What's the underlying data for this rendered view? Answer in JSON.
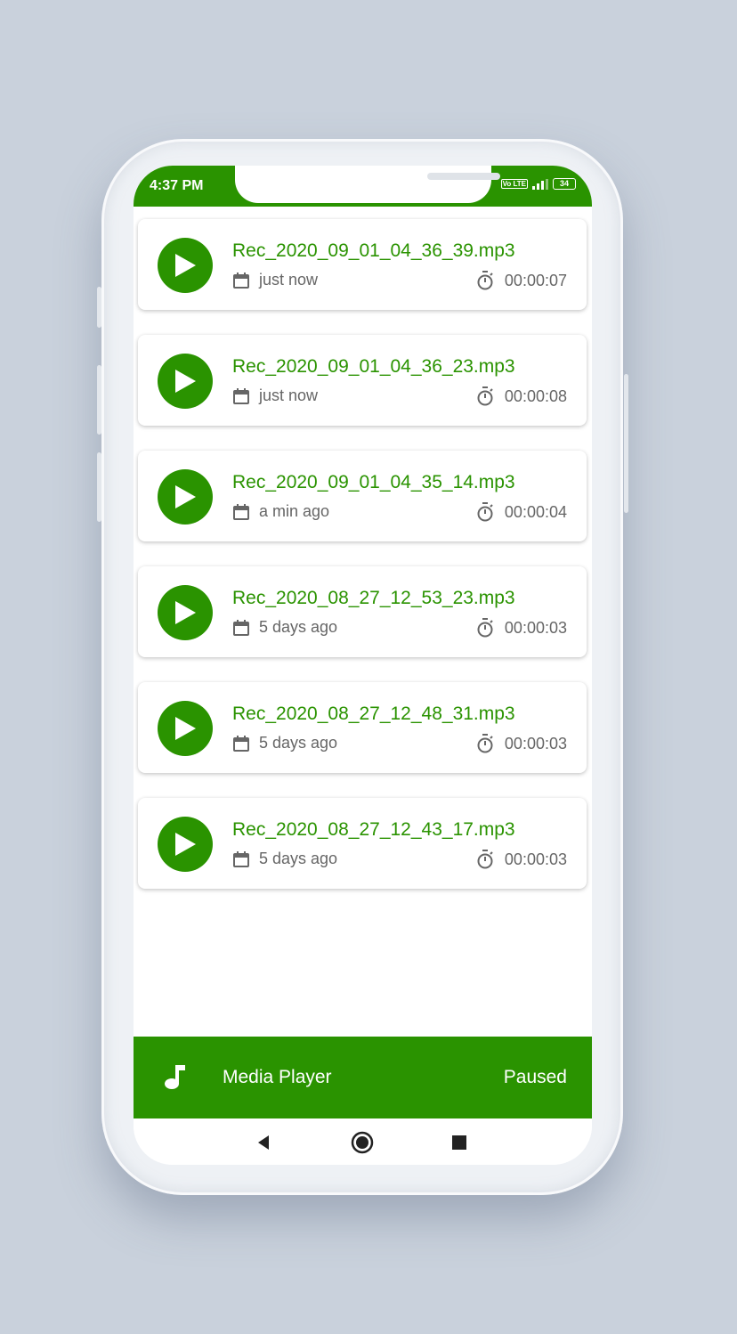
{
  "status_bar": {
    "time": "4:37 PM",
    "volte": "Vo LTE",
    "battery": "34"
  },
  "recordings": [
    {
      "name": "Rec_2020_09_01_04_36_39.mp3",
      "date": "just now",
      "duration": "00:00:07"
    },
    {
      "name": "Rec_2020_09_01_04_36_23.mp3",
      "date": "just now",
      "duration": "00:00:08"
    },
    {
      "name": "Rec_2020_09_01_04_35_14.mp3",
      "date": "a min ago",
      "duration": "00:00:04"
    },
    {
      "name": "Rec_2020_08_27_12_53_23.mp3",
      "date": "5 days ago",
      "duration": "00:00:03"
    },
    {
      "name": "Rec_2020_08_27_12_48_31.mp3",
      "date": "5 days ago",
      "duration": "00:00:03"
    },
    {
      "name": "Rec_2020_08_27_12_43_17.mp3",
      "date": "5 days ago",
      "duration": "00:00:03"
    }
  ],
  "player": {
    "title": "Media Player",
    "state": "Paused"
  },
  "colors": {
    "accent": "#2a9300",
    "text_secondary": "#666666",
    "background": "#c9d1dc"
  },
  "icons": [
    "play-icon",
    "calendar-icon",
    "timer-icon",
    "music-note-icon",
    "back-icon",
    "home-icon",
    "recents-icon"
  ]
}
